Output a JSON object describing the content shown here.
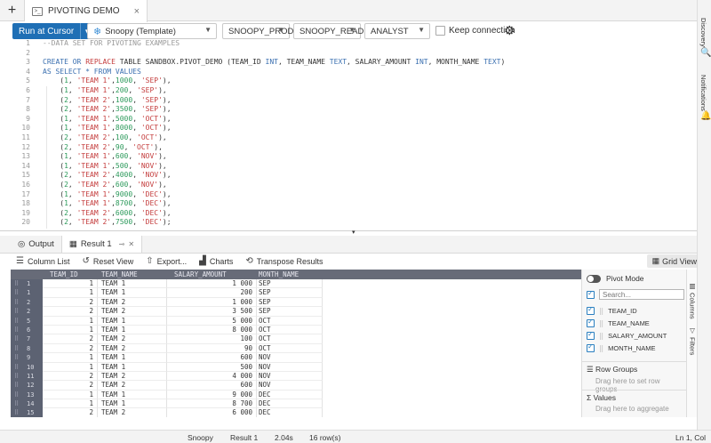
{
  "tabs": {
    "add_label": "+",
    "doc_title": "PIVOTING DEMO",
    "close": "×"
  },
  "toolbar": {
    "run_label": "Run at Cursor",
    "run_arrow": "▼",
    "template": "Snoopy (Template)",
    "database": "SNOOPY_PROD",
    "schema": "SNOOPY_READ",
    "role": "ANALYST",
    "keep_connection": "Keep connection",
    "gear": "⚙"
  },
  "editor": {
    "line_numbers": [
      "1",
      "2",
      "3",
      "4",
      "5",
      "6",
      "7",
      "8",
      "9",
      "10",
      "11",
      "12",
      "13",
      "14",
      "15",
      "16",
      "17",
      "18",
      "19",
      "20"
    ],
    "comment": "--DATA SET FOR PIVOTING EXAMPLES",
    "create_kw": "CREATE OR",
    "replace_kw": "REPLACE",
    "table_kw": "TABLE SANDBOX.PIVOT_DEMO (TEAM_ID",
    "int_kw1": "INT",
    "team_name": ", TEAM_NAME",
    "text_kw1": "TEXT",
    "salary": ", SALARY_AMOUNT",
    "int_kw2": "INT",
    "month": ", MONTH_NAME",
    "text_kw2": "TEXT",
    "close_paren": ")",
    "as_select": "AS SELECT * FROM VALUES",
    "value_rows": [
      {
        "id": "1",
        "team": "'TEAM 1'",
        "amt": "1000",
        "mon": "'SEP'",
        "end": "),"
      },
      {
        "id": "1",
        "team": "'TEAM 1'",
        "amt": "200",
        "mon": "'SEP'",
        "end": "),"
      },
      {
        "id": "2",
        "team": "'TEAM 2'",
        "amt": "1000",
        "mon": "'SEP'",
        "end": "),"
      },
      {
        "id": "2",
        "team": "'TEAM 2'",
        "amt": "3500",
        "mon": "'SEP'",
        "end": "),"
      },
      {
        "id": "1",
        "team": "'TEAM 1'",
        "amt": "5000",
        "mon": "'OCT'",
        "end": "),"
      },
      {
        "id": "1",
        "team": "'TEAM 1'",
        "amt": "8000",
        "mon": "'OCT'",
        "end": "),"
      },
      {
        "id": "2",
        "team": "'TEAM 2'",
        "amt": "100",
        "mon": "'OCT'",
        "end": "),"
      },
      {
        "id": "2",
        "team": "'TEAM 2'",
        "amt": "90",
        "mon": "'OCT'",
        "end": "),"
      },
      {
        "id": "1",
        "team": "'TEAM 1'",
        "amt": "600",
        "mon": "'NOV'",
        "end": "),"
      },
      {
        "id": "1",
        "team": "'TEAM 1'",
        "amt": "500",
        "mon": "'NOV'",
        "end": "),"
      },
      {
        "id": "2",
        "team": "'TEAM 2'",
        "amt": "4000",
        "mon": "'NOV'",
        "end": "),"
      },
      {
        "id": "2",
        "team": "'TEAM 2'",
        "amt": "600",
        "mon": "'NOV'",
        "end": "),"
      },
      {
        "id": "1",
        "team": "'TEAM 1'",
        "amt": "9000",
        "mon": "'DEC'",
        "end": "),"
      },
      {
        "id": "1",
        "team": "'TEAM 1'",
        "amt": "8700",
        "mon": "'DEC'",
        "end": "),"
      },
      {
        "id": "2",
        "team": "'TEAM 2'",
        "amt": "6000",
        "mon": "'DEC'",
        "end": "),"
      },
      {
        "id": "2",
        "team": "'TEAM 2'",
        "amt": "7500",
        "mon": "'DEC'",
        "end": ");"
      }
    ]
  },
  "bottom_tabs": {
    "output": "Output",
    "result": "Result 1"
  },
  "result_toolbar": {
    "column_list": "Column List",
    "reset_view": "Reset View",
    "export": "Export...",
    "charts": "Charts",
    "transpose": "Transpose Results",
    "grid_view": "Grid View"
  },
  "grid": {
    "headers": [
      "TEAM_ID",
      "TEAM_NAME",
      "SALARY_AMOUNT",
      "MONTH_NAME"
    ],
    "rows": [
      {
        "n": "1",
        "id": "1",
        "team": "TEAM 1",
        "amt": "1 000",
        "mon": "SEP"
      },
      {
        "n": "1",
        "id": "1",
        "team": "TEAM 1",
        "amt": "200",
        "mon": "SEP"
      },
      {
        "n": "2",
        "id": "2",
        "team": "TEAM 2",
        "amt": "1 000",
        "mon": "SEP"
      },
      {
        "n": "2",
        "id": "2",
        "team": "TEAM 2",
        "amt": "3 500",
        "mon": "SEP"
      },
      {
        "n": "5",
        "id": "1",
        "team": "TEAM 1",
        "amt": "5 000",
        "mon": "OCT"
      },
      {
        "n": "6",
        "id": "1",
        "team": "TEAM 1",
        "amt": "8 000",
        "mon": "OCT"
      },
      {
        "n": "7",
        "id": "2",
        "team": "TEAM 2",
        "amt": "100",
        "mon": "OCT"
      },
      {
        "n": "8",
        "id": "2",
        "team": "TEAM 2",
        "amt": "90",
        "mon": "OCT"
      },
      {
        "n": "9",
        "id": "1",
        "team": "TEAM 1",
        "amt": "600",
        "mon": "NOV"
      },
      {
        "n": "10",
        "id": "1",
        "team": "TEAM 1",
        "amt": "500",
        "mon": "NOV"
      },
      {
        "n": "11",
        "id": "2",
        "team": "TEAM 2",
        "amt": "4 000",
        "mon": "NOV"
      },
      {
        "n": "12",
        "id": "2",
        "team": "TEAM 2",
        "amt": "600",
        "mon": "NOV"
      },
      {
        "n": "13",
        "id": "1",
        "team": "TEAM 1",
        "amt": "9 000",
        "mon": "DEC"
      },
      {
        "n": "14",
        "id": "1",
        "team": "TEAM 1",
        "amt": "8 700",
        "mon": "DEC"
      },
      {
        "n": "15",
        "id": "2",
        "team": "TEAM 2",
        "amt": "6 000",
        "mon": "DEC"
      }
    ]
  },
  "side_panel": {
    "pivot_mode": "Pivot Mode",
    "search_placeholder": "Search...",
    "fields": [
      "TEAM_ID",
      "TEAM_NAME",
      "SALARY_AMOUNT",
      "MONTH_NAME"
    ],
    "row_groups": "Row Groups",
    "row_groups_hint": "Drag here to set row groups",
    "values": "Values",
    "values_hint": "Drag here to aggregate",
    "columns_tab": "Columns",
    "filters_tab": "Filters"
  },
  "right_sidebar": {
    "discovery": "Discovery",
    "notifications": "Notifications"
  },
  "status": {
    "source": "Snoopy",
    "result": "Result 1",
    "time": "2.04s",
    "rows": "16 row(s)",
    "cursor": "Ln 1, Col 1"
  },
  "colors": {
    "accent": "#1f6fb5",
    "grid_header": "#676b78",
    "keyword": "#3a6fb0",
    "string": "#c43d3d",
    "number": "#2c9a5b"
  }
}
